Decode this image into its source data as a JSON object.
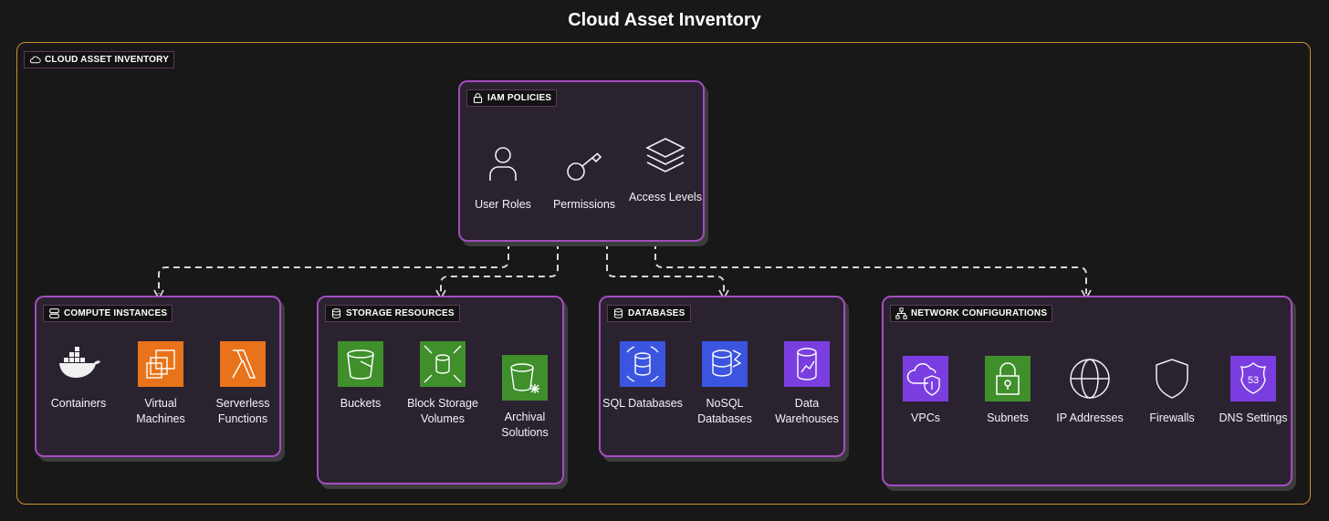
{
  "title": "Cloud Asset Inventory",
  "outer_label": "CLOUD ASSET INVENTORY",
  "colors": {
    "border_outer": "#c8922e",
    "box_border": "#a44cc0",
    "box_fill": "#2b2230",
    "orange": "#e8731a",
    "green": "#3f8f2a",
    "blue": "#3b55e0",
    "purple": "#7a3ee0"
  },
  "groups": [
    {
      "id": "iam",
      "label": "IAM POLICIES",
      "icon": "lock-icon",
      "items": [
        {
          "label": "User Roles",
          "icon": "user"
        },
        {
          "label": "Permissions",
          "icon": "key"
        },
        {
          "label": "Access Levels",
          "icon": "layers"
        }
      ]
    },
    {
      "id": "compute",
      "label": "COMPUTE INSTANCES",
      "icon": "server-icon",
      "items": [
        {
          "label": "Containers",
          "icon": "docker"
        },
        {
          "label": "Virtual Machines",
          "icon": "chip"
        },
        {
          "label": "Serverless Functions",
          "icon": "lambda"
        }
      ]
    },
    {
      "id": "storage",
      "label": "STORAGE RESOURCES",
      "icon": "database-icon",
      "items": [
        {
          "label": "Buckets",
          "icon": "bucket"
        },
        {
          "label": "Block Storage Volumes",
          "icon": "block"
        },
        {
          "label": "Archival Solutions",
          "icon": "archive"
        }
      ]
    },
    {
      "id": "databases",
      "label": "DATABASES",
      "icon": "database-icon",
      "items": [
        {
          "label": "SQL Databases",
          "icon": "sql"
        },
        {
          "label": "NoSQL Databases",
          "icon": "nosql"
        },
        {
          "label": "Data Warehouses",
          "icon": "warehouse"
        }
      ]
    },
    {
      "id": "network",
      "label": "NETWORK CONFIGURATIONS",
      "icon": "network-icon",
      "items": [
        {
          "label": "VPCs",
          "icon": "vpc"
        },
        {
          "label": "Subnets",
          "icon": "subnet"
        },
        {
          "label": "IP Addresses",
          "icon": "globe"
        },
        {
          "label": "Firewalls",
          "icon": "shield"
        },
        {
          "label": "DNS Settings",
          "icon": "dns"
        }
      ]
    }
  ]
}
